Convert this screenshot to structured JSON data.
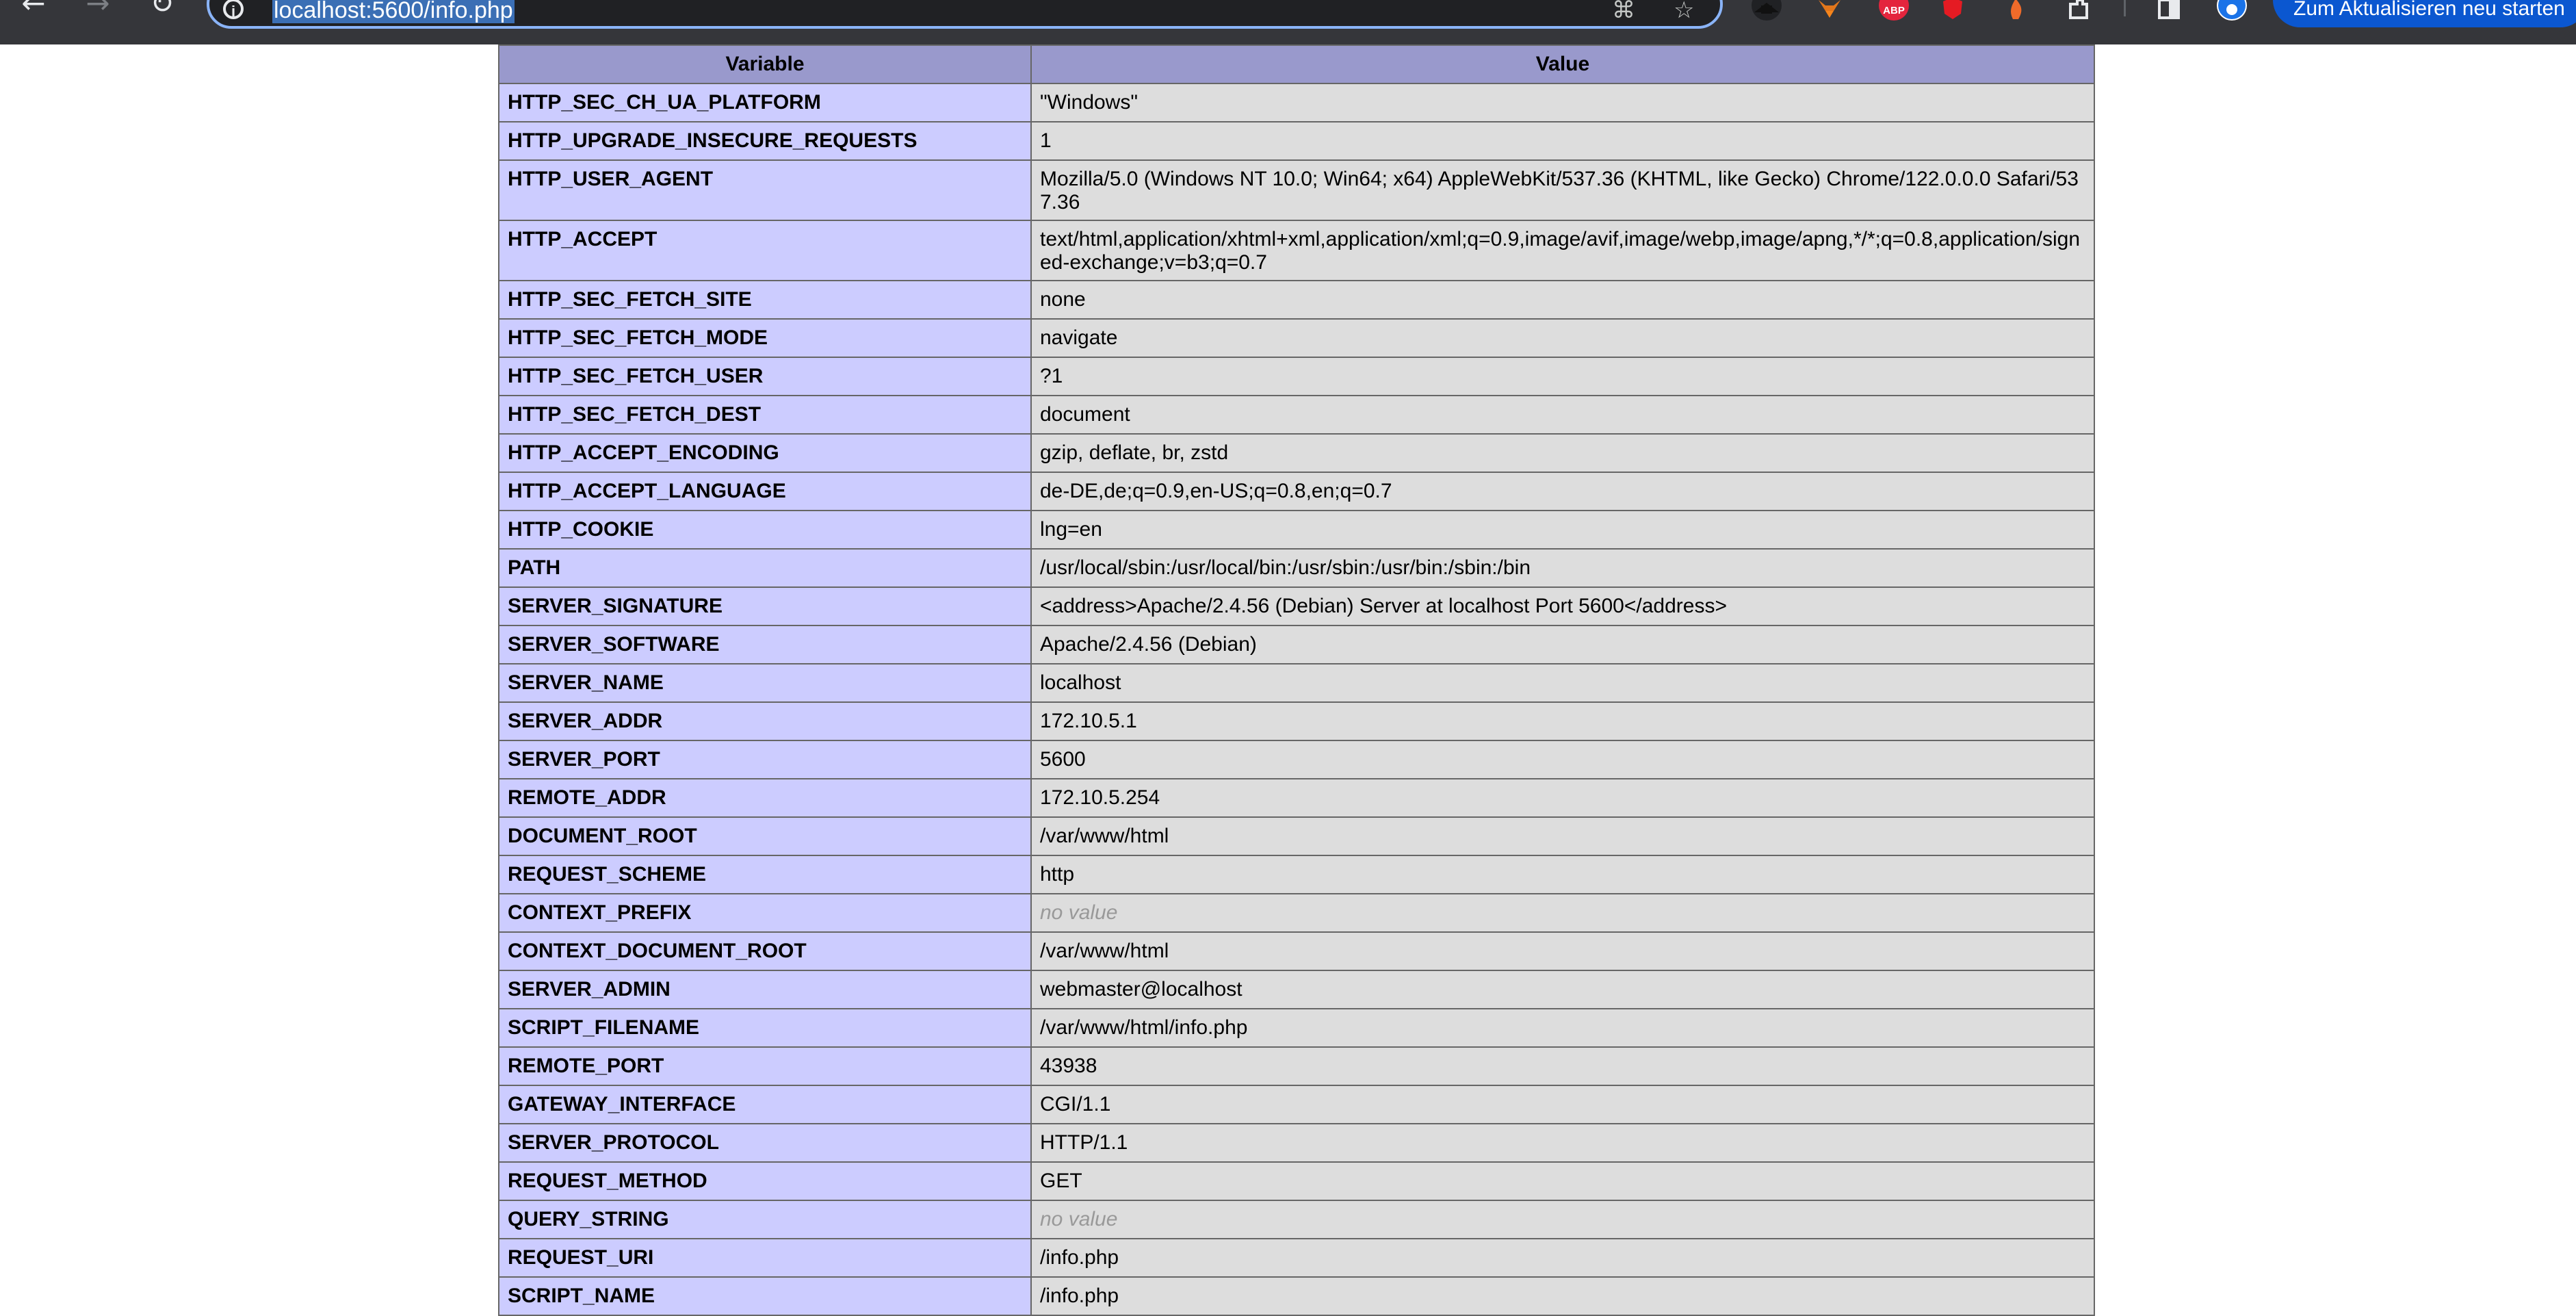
{
  "browser": {
    "url": "localhost:5600/info.php",
    "update_button_label": "Zum Aktualisieren neu starten",
    "abp_badge": "ABP"
  },
  "table": {
    "header_variable": "Variable",
    "header_value": "Value",
    "rows": [
      {
        "name": "HTTP_SEC_CH_UA_PLATFORM",
        "value": "\"Windows\""
      },
      {
        "name": "HTTP_UPGRADE_INSECURE_REQUESTS",
        "value": "1"
      },
      {
        "name": "HTTP_USER_AGENT",
        "value": "Mozilla/5.0 (Windows NT 10.0; Win64; x64) AppleWebKit/537.36 (KHTML, like Gecko) Chrome/122.0.0.0 Safari/537.36"
      },
      {
        "name": "HTTP_ACCEPT",
        "value": "text/html,application/xhtml+xml,application/xml;q=0.9,image/avif,image/webp,image/apng,*/*;q=0.8,application/signed-exchange;v=b3;q=0.7"
      },
      {
        "name": "HTTP_SEC_FETCH_SITE",
        "value": "none"
      },
      {
        "name": "HTTP_SEC_FETCH_MODE",
        "value": "navigate"
      },
      {
        "name": "HTTP_SEC_FETCH_USER",
        "value": "?1"
      },
      {
        "name": "HTTP_SEC_FETCH_DEST",
        "value": "document"
      },
      {
        "name": "HTTP_ACCEPT_ENCODING",
        "value": "gzip, deflate, br, zstd"
      },
      {
        "name": "HTTP_ACCEPT_LANGUAGE",
        "value": "de-DE,de;q=0.9,en-US;q=0.8,en;q=0.7"
      },
      {
        "name": "HTTP_COOKIE",
        "value": "lng=en"
      },
      {
        "name": "PATH",
        "value": "/usr/local/sbin:/usr/local/bin:/usr/sbin:/usr/bin:/sbin:/bin"
      },
      {
        "name": "SERVER_SIGNATURE",
        "value": "<address>Apache/2.4.56 (Debian) Server at localhost Port 5600</address>"
      },
      {
        "name": "SERVER_SOFTWARE",
        "value": "Apache/2.4.56 (Debian)"
      },
      {
        "name": "SERVER_NAME",
        "value": "localhost"
      },
      {
        "name": "SERVER_ADDR",
        "value": "172.10.5.1"
      },
      {
        "name": "SERVER_PORT",
        "value": "5600"
      },
      {
        "name": "REMOTE_ADDR",
        "value": "172.10.5.254"
      },
      {
        "name": "DOCUMENT_ROOT",
        "value": "/var/www/html"
      },
      {
        "name": "REQUEST_SCHEME",
        "value": "http"
      },
      {
        "name": "CONTEXT_PREFIX",
        "value": "no value",
        "novalue": true
      },
      {
        "name": "CONTEXT_DOCUMENT_ROOT",
        "value": "/var/www/html"
      },
      {
        "name": "SERVER_ADMIN",
        "value": "webmaster@localhost"
      },
      {
        "name": "SCRIPT_FILENAME",
        "value": "/var/www/html/info.php"
      },
      {
        "name": "REMOTE_PORT",
        "value": "43938"
      },
      {
        "name": "GATEWAY_INTERFACE",
        "value": "CGI/1.1"
      },
      {
        "name": "SERVER_PROTOCOL",
        "value": "HTTP/1.1"
      },
      {
        "name": "REQUEST_METHOD",
        "value": "GET"
      },
      {
        "name": "QUERY_STRING",
        "value": "no value",
        "novalue": true
      },
      {
        "name": "REQUEST_URI",
        "value": "/info.php"
      },
      {
        "name": "SCRIPT_NAME",
        "value": "/info.php"
      }
    ]
  }
}
